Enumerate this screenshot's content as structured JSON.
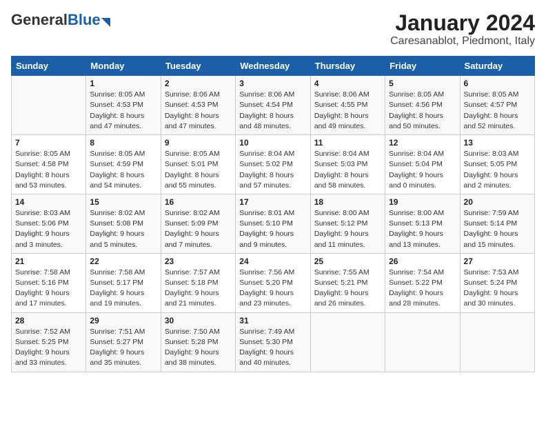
{
  "header": {
    "logo_general": "General",
    "logo_blue": "Blue",
    "title": "January 2024",
    "subtitle": "Caresanablot, Piedmont, Italy"
  },
  "columns": [
    "Sunday",
    "Monday",
    "Tuesday",
    "Wednesday",
    "Thursday",
    "Friday",
    "Saturday"
  ],
  "weeks": [
    [
      {
        "day": "",
        "info": ""
      },
      {
        "day": "1",
        "info": "Sunrise: 8:05 AM\nSunset: 4:53 PM\nDaylight: 8 hours\nand 47 minutes."
      },
      {
        "day": "2",
        "info": "Sunrise: 8:06 AM\nSunset: 4:53 PM\nDaylight: 8 hours\nand 47 minutes."
      },
      {
        "day": "3",
        "info": "Sunrise: 8:06 AM\nSunset: 4:54 PM\nDaylight: 8 hours\nand 48 minutes."
      },
      {
        "day": "4",
        "info": "Sunrise: 8:06 AM\nSunset: 4:55 PM\nDaylight: 8 hours\nand 49 minutes."
      },
      {
        "day": "5",
        "info": "Sunrise: 8:05 AM\nSunset: 4:56 PM\nDaylight: 8 hours\nand 50 minutes."
      },
      {
        "day": "6",
        "info": "Sunrise: 8:05 AM\nSunset: 4:57 PM\nDaylight: 8 hours\nand 52 minutes."
      }
    ],
    [
      {
        "day": "7",
        "info": "Sunrise: 8:05 AM\nSunset: 4:58 PM\nDaylight: 8 hours\nand 53 minutes."
      },
      {
        "day": "8",
        "info": "Sunrise: 8:05 AM\nSunset: 4:59 PM\nDaylight: 8 hours\nand 54 minutes."
      },
      {
        "day": "9",
        "info": "Sunrise: 8:05 AM\nSunset: 5:01 PM\nDaylight: 8 hours\nand 55 minutes."
      },
      {
        "day": "10",
        "info": "Sunrise: 8:04 AM\nSunset: 5:02 PM\nDaylight: 8 hours\nand 57 minutes."
      },
      {
        "day": "11",
        "info": "Sunrise: 8:04 AM\nSunset: 5:03 PM\nDaylight: 8 hours\nand 58 minutes."
      },
      {
        "day": "12",
        "info": "Sunrise: 8:04 AM\nSunset: 5:04 PM\nDaylight: 9 hours\nand 0 minutes."
      },
      {
        "day": "13",
        "info": "Sunrise: 8:03 AM\nSunset: 5:05 PM\nDaylight: 9 hours\nand 2 minutes."
      }
    ],
    [
      {
        "day": "14",
        "info": "Sunrise: 8:03 AM\nSunset: 5:06 PM\nDaylight: 9 hours\nand 3 minutes."
      },
      {
        "day": "15",
        "info": "Sunrise: 8:02 AM\nSunset: 5:08 PM\nDaylight: 9 hours\nand 5 minutes."
      },
      {
        "day": "16",
        "info": "Sunrise: 8:02 AM\nSunset: 5:09 PM\nDaylight: 9 hours\nand 7 minutes."
      },
      {
        "day": "17",
        "info": "Sunrise: 8:01 AM\nSunset: 5:10 PM\nDaylight: 9 hours\nand 9 minutes."
      },
      {
        "day": "18",
        "info": "Sunrise: 8:00 AM\nSunset: 5:12 PM\nDaylight: 9 hours\nand 11 minutes."
      },
      {
        "day": "19",
        "info": "Sunrise: 8:00 AM\nSunset: 5:13 PM\nDaylight: 9 hours\nand 13 minutes."
      },
      {
        "day": "20",
        "info": "Sunrise: 7:59 AM\nSunset: 5:14 PM\nDaylight: 9 hours\nand 15 minutes."
      }
    ],
    [
      {
        "day": "21",
        "info": "Sunrise: 7:58 AM\nSunset: 5:16 PM\nDaylight: 9 hours\nand 17 minutes."
      },
      {
        "day": "22",
        "info": "Sunrise: 7:58 AM\nSunset: 5:17 PM\nDaylight: 9 hours\nand 19 minutes."
      },
      {
        "day": "23",
        "info": "Sunrise: 7:57 AM\nSunset: 5:18 PM\nDaylight: 9 hours\nand 21 minutes."
      },
      {
        "day": "24",
        "info": "Sunrise: 7:56 AM\nSunset: 5:20 PM\nDaylight: 9 hours\nand 23 minutes."
      },
      {
        "day": "25",
        "info": "Sunrise: 7:55 AM\nSunset: 5:21 PM\nDaylight: 9 hours\nand 26 minutes."
      },
      {
        "day": "26",
        "info": "Sunrise: 7:54 AM\nSunset: 5:22 PM\nDaylight: 9 hours\nand 28 minutes."
      },
      {
        "day": "27",
        "info": "Sunrise: 7:53 AM\nSunset: 5:24 PM\nDaylight: 9 hours\nand 30 minutes."
      }
    ],
    [
      {
        "day": "28",
        "info": "Sunrise: 7:52 AM\nSunset: 5:25 PM\nDaylight: 9 hours\nand 33 minutes."
      },
      {
        "day": "29",
        "info": "Sunrise: 7:51 AM\nSunset: 5:27 PM\nDaylight: 9 hours\nand 35 minutes."
      },
      {
        "day": "30",
        "info": "Sunrise: 7:50 AM\nSunset: 5:28 PM\nDaylight: 9 hours\nand 38 minutes."
      },
      {
        "day": "31",
        "info": "Sunrise: 7:49 AM\nSunset: 5:30 PM\nDaylight: 9 hours\nand 40 minutes."
      },
      {
        "day": "",
        "info": ""
      },
      {
        "day": "",
        "info": ""
      },
      {
        "day": "",
        "info": ""
      }
    ]
  ]
}
